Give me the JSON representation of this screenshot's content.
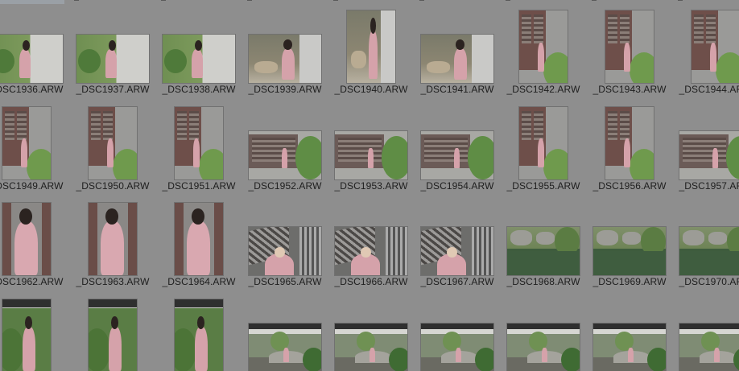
{
  "files": [
    {
      "name": "_DSC1936.ARW",
      "orient": "landscape",
      "scene": "garden-girl"
    },
    {
      "name": "_DSC1937.ARW",
      "orient": "landscape",
      "scene": "garden-girl"
    },
    {
      "name": "_DSC1938.ARW",
      "orient": "landscape",
      "scene": "garden-girl"
    },
    {
      "name": "_DSC1939.ARW",
      "orient": "landscape",
      "scene": "table-girl"
    },
    {
      "name": "_DSC1940.ARW",
      "orient": "portrait",
      "scene": "table-girl"
    },
    {
      "name": "_DSC1941.ARW",
      "orient": "landscape",
      "scene": "table-girl"
    },
    {
      "name": "_DSC1942.ARW",
      "orient": "portrait",
      "scene": "door-girl"
    },
    {
      "name": "_DSC1943.ARW",
      "orient": "portrait",
      "scene": "door-girl"
    },
    {
      "name": "_DSC1944.ARW",
      "orient": "portrait",
      "scene": "door-girl"
    },
    {
      "name": "_DSC1949.ARW",
      "orient": "portrait",
      "scene": "door-girl"
    },
    {
      "name": "_DSC1950.ARW",
      "orient": "portrait",
      "scene": "door-girl"
    },
    {
      "name": "_DSC1951.ARW",
      "orient": "portrait",
      "scene": "door-girl"
    },
    {
      "name": "_DSC1952.ARW",
      "orient": "landscape",
      "scene": "house-wide"
    },
    {
      "name": "_DSC1953.ARW",
      "orient": "landscape",
      "scene": "house-wide"
    },
    {
      "name": "_DSC1954.ARW",
      "orient": "landscape",
      "scene": "house-wide"
    },
    {
      "name": "_DSC1955.ARW",
      "orient": "portrait",
      "scene": "door-girl"
    },
    {
      "name": "_DSC1956.ARW",
      "orient": "portrait",
      "scene": "door-girl"
    },
    {
      "name": "_DSC1957.ARW",
      "orient": "landscape",
      "scene": "house-wide"
    },
    {
      "name": "_DSC1962.ARW",
      "orient": "portrait",
      "scene": "girl-close"
    },
    {
      "name": "_DSC1963.ARW",
      "orient": "portrait",
      "scene": "girl-close"
    },
    {
      "name": "_DSC1964.ARW",
      "orient": "portrait",
      "scene": "girl-close"
    },
    {
      "name": "_DSC1965.ARW",
      "orient": "landscape",
      "scene": "lattice-girl"
    },
    {
      "name": "_DSC1966.ARW",
      "orient": "landscape",
      "scene": "lattice-girl"
    },
    {
      "name": "_DSC1967.ARW",
      "orient": "landscape",
      "scene": "lattice-girl"
    },
    {
      "name": "_DSC1968.ARW",
      "orient": "landscape",
      "scene": "pond"
    },
    {
      "name": "_DSC1969.ARW",
      "orient": "landscape",
      "scene": "pond"
    },
    {
      "name": "_DSC1970.ARW",
      "orient": "landscape",
      "scene": "pond"
    },
    {
      "name": "",
      "orient": "portrait",
      "scene": "garden-portrait"
    },
    {
      "name": "",
      "orient": "portrait",
      "scene": "garden-portrait"
    },
    {
      "name": "",
      "orient": "portrait",
      "scene": "garden-portrait"
    },
    {
      "name": "",
      "orient": "landscape",
      "scene": "bridge"
    },
    {
      "name": "",
      "orient": "landscape",
      "scene": "bridge"
    },
    {
      "name": "",
      "orient": "landscape",
      "scene": "bridge"
    },
    {
      "name": "",
      "orient": "landscape",
      "scene": "bridge"
    },
    {
      "name": "",
      "orient": "landscape",
      "scene": "bridge"
    },
    {
      "name": "",
      "orient": "landscape",
      "scene": "bridge"
    }
  ]
}
